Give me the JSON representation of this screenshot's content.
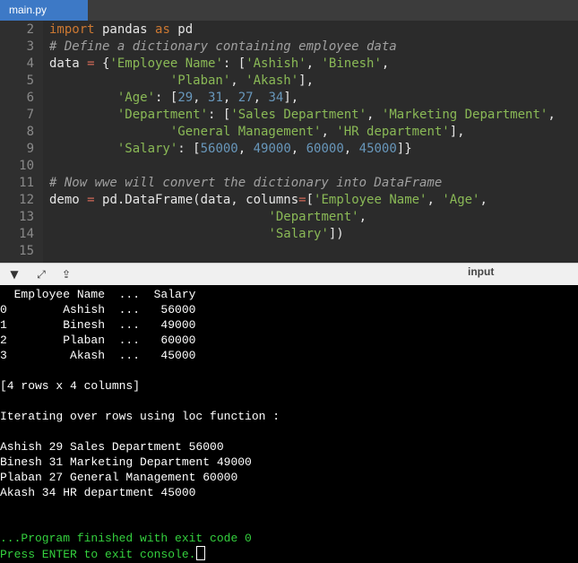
{
  "tab": {
    "title": "main.py"
  },
  "editor": {
    "lines": [
      {
        "num": "2",
        "segments": [
          {
            "t": "import",
            "c": "kw"
          },
          {
            "t": " pandas ",
            "c": ""
          },
          {
            "t": "as",
            "c": "kw"
          },
          {
            "t": " pd",
            "c": ""
          }
        ]
      },
      {
        "num": "3",
        "segments": [
          {
            "t": "# Define a dictionary containing employee data",
            "c": "cm"
          }
        ]
      },
      {
        "num": "4",
        "segments": [
          {
            "t": "data ",
            "c": ""
          },
          {
            "t": "=",
            "c": "op"
          },
          {
            "t": " {",
            "c": ""
          },
          {
            "t": "'Employee Name'",
            "c": "st"
          },
          {
            "t": ": [",
            "c": ""
          },
          {
            "t": "'Ashish'",
            "c": "st"
          },
          {
            "t": ", ",
            "c": ""
          },
          {
            "t": "'Binesh'",
            "c": "st"
          },
          {
            "t": ",",
            "c": ""
          }
        ]
      },
      {
        "num": "5",
        "segments": [
          {
            "t": "                ",
            "c": ""
          },
          {
            "t": "'Plaban'",
            "c": "st"
          },
          {
            "t": ", ",
            "c": ""
          },
          {
            "t": "'Akash'",
            "c": "st"
          },
          {
            "t": "],",
            "c": ""
          }
        ]
      },
      {
        "num": "6",
        "segments": [
          {
            "t": "         ",
            "c": ""
          },
          {
            "t": "'Age'",
            "c": "st"
          },
          {
            "t": ": [",
            "c": ""
          },
          {
            "t": "29",
            "c": "nm"
          },
          {
            "t": ", ",
            "c": ""
          },
          {
            "t": "31",
            "c": "nm"
          },
          {
            "t": ", ",
            "c": ""
          },
          {
            "t": "27",
            "c": "nm"
          },
          {
            "t": ", ",
            "c": ""
          },
          {
            "t": "34",
            "c": "nm"
          },
          {
            "t": "],",
            "c": ""
          }
        ]
      },
      {
        "num": "7",
        "segments": [
          {
            "t": "         ",
            "c": ""
          },
          {
            "t": "'Department'",
            "c": "st"
          },
          {
            "t": ": [",
            "c": ""
          },
          {
            "t": "'Sales Department'",
            "c": "st"
          },
          {
            "t": ", ",
            "c": ""
          },
          {
            "t": "'Marketing Department'",
            "c": "st"
          },
          {
            "t": ",",
            "c": ""
          }
        ]
      },
      {
        "num": "8",
        "segments": [
          {
            "t": "                ",
            "c": ""
          },
          {
            "t": "'General Management'",
            "c": "st"
          },
          {
            "t": ", ",
            "c": ""
          },
          {
            "t": "'HR department'",
            "c": "st"
          },
          {
            "t": "],",
            "c": ""
          }
        ]
      },
      {
        "num": "9",
        "segments": [
          {
            "t": "         ",
            "c": ""
          },
          {
            "t": "'Salary'",
            "c": "st"
          },
          {
            "t": ": [",
            "c": ""
          },
          {
            "t": "56000",
            "c": "nm"
          },
          {
            "t": ", ",
            "c": ""
          },
          {
            "t": "49000",
            "c": "nm"
          },
          {
            "t": ", ",
            "c": ""
          },
          {
            "t": "60000",
            "c": "nm"
          },
          {
            "t": ", ",
            "c": ""
          },
          {
            "t": "45000",
            "c": "nm"
          },
          {
            "t": "]}",
            "c": ""
          }
        ]
      },
      {
        "num": "10",
        "segments": []
      },
      {
        "num": "11",
        "segments": [
          {
            "t": "# Now wwe will convert the dictionary into DataFrame",
            "c": "cm"
          }
        ]
      },
      {
        "num": "12",
        "segments": [
          {
            "t": "demo ",
            "c": ""
          },
          {
            "t": "=",
            "c": "op"
          },
          {
            "t": " pd.DataFrame(data, columns",
            "c": ""
          },
          {
            "t": "=",
            "c": "op"
          },
          {
            "t": "[",
            "c": ""
          },
          {
            "t": "'Employee Name'",
            "c": "st"
          },
          {
            "t": ", ",
            "c": ""
          },
          {
            "t": "'Age'",
            "c": "st"
          },
          {
            "t": ",",
            "c": ""
          }
        ]
      },
      {
        "num": "13",
        "segments": [
          {
            "t": "                             ",
            "c": ""
          },
          {
            "t": "'Department'",
            "c": "st"
          },
          {
            "t": ",",
            "c": ""
          }
        ]
      },
      {
        "num": "14",
        "segments": [
          {
            "t": "                             ",
            "c": ""
          },
          {
            "t": "'Salary'",
            "c": "st"
          },
          {
            "t": "])",
            "c": ""
          }
        ]
      },
      {
        "num": "15",
        "segments": []
      }
    ]
  },
  "console_toolbar": {
    "label": "input",
    "icons": [
      "chevron-down-icon",
      "expand-icon",
      "share-icon"
    ]
  },
  "console": {
    "lines": [
      {
        "text": "  Employee Name  ...  Salary",
        "c": ""
      },
      {
        "text": "0        Ashish  ...   56000",
        "c": ""
      },
      {
        "text": "1        Binesh  ...   49000",
        "c": ""
      },
      {
        "text": "2        Plaban  ...   60000",
        "c": ""
      },
      {
        "text": "3         Akash  ...   45000",
        "c": ""
      },
      {
        "text": "",
        "c": ""
      },
      {
        "text": "[4 rows x 4 columns]",
        "c": ""
      },
      {
        "text": "",
        "c": ""
      },
      {
        "text": "Iterating over rows using loc function :",
        "c": ""
      },
      {
        "text": "",
        "c": ""
      },
      {
        "text": "Ashish 29 Sales Department 56000",
        "c": ""
      },
      {
        "text": "Binesh 31 Marketing Department 49000",
        "c": ""
      },
      {
        "text": "Plaban 27 General Management 60000",
        "c": ""
      },
      {
        "text": "Akash 34 HR department 45000",
        "c": ""
      },
      {
        "text": "",
        "c": ""
      },
      {
        "text": "",
        "c": ""
      },
      {
        "text": "...Program finished with exit code 0",
        "c": "green"
      },
      {
        "text": "Press ENTER to exit console.",
        "c": "green",
        "cursor": true
      }
    ]
  }
}
